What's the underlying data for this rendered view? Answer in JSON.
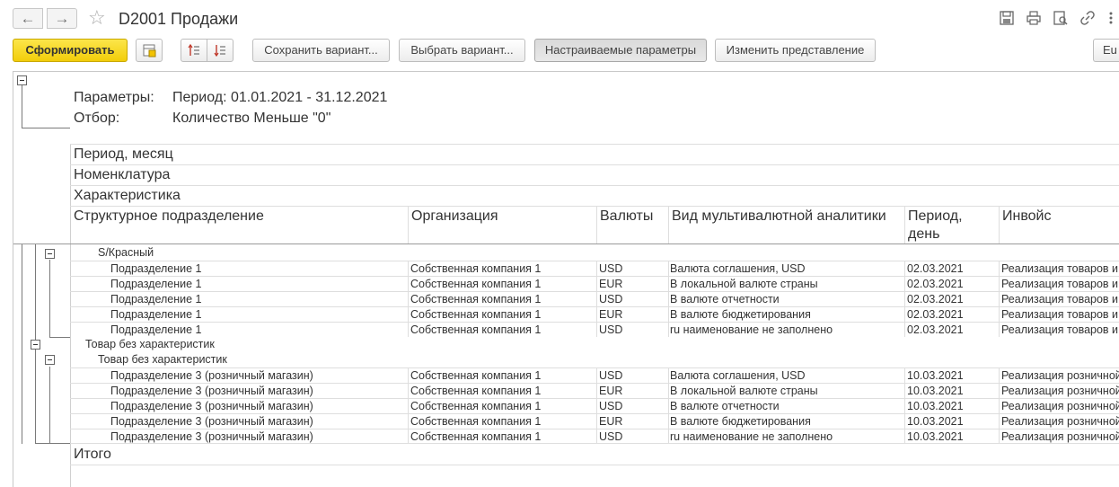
{
  "window": {
    "title": "D2001 Продажи",
    "back_icon": "←",
    "forward_icon": "→",
    "star_icon": "☆"
  },
  "toolbar": {
    "generate_label": "Сформировать",
    "save_variant_label": "Сохранить вариант...",
    "choose_variant_label": "Выбрать вариант...",
    "custom_params_label": "Настраиваемые параметры",
    "change_view_label": "Изменить представление",
    "cut_label": "Eu"
  },
  "report": {
    "params_label": "Параметры:",
    "params_value": "Период: 01.01.2021 - 31.12.2021",
    "filter_label": "Отбор:",
    "filter_value": "Количество Меньше \"0\"",
    "grouping_rows": [
      "Период, месяц",
      "Номенклатура",
      "Характеристика"
    ],
    "columns": [
      "Структурное подразделение",
      "Организация",
      "Валюты",
      "Вид мультивалютной аналитики",
      "Период, день",
      "Инвойс"
    ],
    "column_period_line1": "Период,",
    "column_period_line2": "день",
    "group1_label": "S/Красный",
    "group1_rows": [
      [
        "Подразделение 1",
        "Собственная компания 1",
        "USD",
        "Валюта соглашения, USD",
        "02.03.2021",
        "Реализация товаров и"
      ],
      [
        "Подразделение 1",
        "Собственная компания 1",
        "EUR",
        "В локальной валюте страны",
        "02.03.2021",
        "Реализация товаров и"
      ],
      [
        "Подразделение 1",
        "Собственная компания 1",
        "USD",
        "В валюте отчетности",
        "02.03.2021",
        "Реализация товаров и"
      ],
      [
        "Подразделение 1",
        "Собственная компания 1",
        "EUR",
        "В валюте бюджетирования",
        "02.03.2021",
        "Реализация товаров и"
      ],
      [
        "Подразделение 1",
        "Собственная компания 1",
        "USD",
        "ru наименование не заполнено",
        "02.03.2021",
        "Реализация товаров и"
      ]
    ],
    "group2_label": "Товар без характеристик",
    "group2_sub_label": "Товар без характеристик",
    "group2_rows": [
      [
        "Подразделение 3 (розничный магазин)",
        "Собственная компания 1",
        "USD",
        "Валюта соглашения, USD",
        "10.03.2021",
        "Реализация розничной"
      ],
      [
        "Подразделение 3 (розничный магазин)",
        "Собственная компания 1",
        "EUR",
        "В локальной валюте страны",
        "10.03.2021",
        "Реализация розничной"
      ],
      [
        "Подразделение 3 (розничный магазин)",
        "Собственная компания 1",
        "USD",
        "В валюте отчетности",
        "10.03.2021",
        "Реализация розничной"
      ],
      [
        "Подразделение 3 (розничный магазин)",
        "Собственная компания 1",
        "EUR",
        "В валюте бюджетирования",
        "10.03.2021",
        "Реализация розничной"
      ],
      [
        "Подразделение 3 (розничный магазин)",
        "Собственная компания 1",
        "USD",
        "ru наименование не заполнено",
        "10.03.2021",
        "Реализация розничной"
      ]
    ],
    "total_label": "Итого"
  },
  "colors": {
    "primary_button": "#f2cd0a",
    "grid_line": "#dedede",
    "tree_line": "#7a7a7a"
  }
}
